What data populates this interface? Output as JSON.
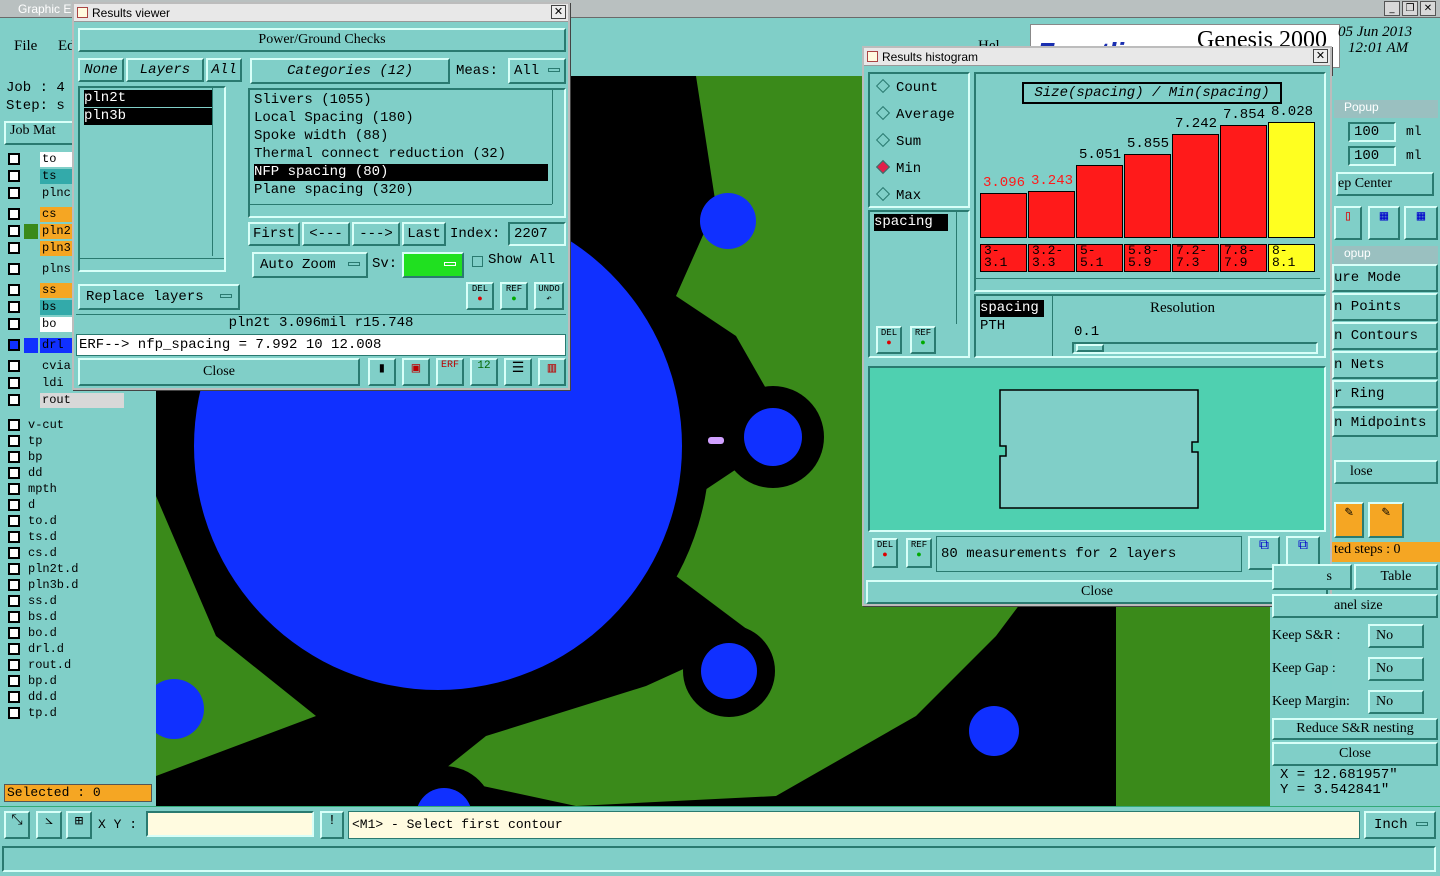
{
  "app": {
    "title": "Graphic E",
    "menu": [
      "File",
      "Ed"
    ],
    "brand": "Genesis 2000",
    "brand_logo": "Frontline",
    "date": "05 Jun 2013",
    "time": "12:01 AM",
    "help": "Hel"
  },
  "left": {
    "job_label": "Job  :  4",
    "step_label": "Step:  s",
    "job_matrix": "Job Mat",
    "layers": [
      {
        "name": "to",
        "color": "#ffffff",
        "style": "w"
      },
      {
        "name": "ts",
        "color": "#3aa",
        "style": "g"
      },
      {
        "name": "plnc",
        "color": "#80cfc8",
        "style": "n"
      },
      {
        "name": "cs",
        "color": "#f5a623",
        "style": "o"
      },
      {
        "name": "pln2",
        "color": "#e0a020",
        "style": "o2"
      },
      {
        "name": "pln3",
        "color": "#e0a020",
        "style": "o"
      },
      {
        "name": "plns",
        "color": "#80cfc8",
        "style": "n"
      },
      {
        "name": "ss",
        "color": "#f5a623",
        "style": "o"
      },
      {
        "name": "bs",
        "color": "#3aa",
        "style": "g"
      },
      {
        "name": "bo",
        "color": "#ffffff",
        "style": "w"
      },
      {
        "name": "drl",
        "color": "#1030ff",
        "style": "b"
      },
      {
        "name": "cvia",
        "color": "#80cfc8",
        "style": "n"
      },
      {
        "name": "ldi",
        "color": "#80cfc8",
        "style": "n"
      },
      {
        "name": "rout",
        "color": "#d8d8d8",
        "style": "gr"
      }
    ],
    "layers2": [
      "v-cut",
      "tp",
      "bp",
      "dd",
      "mpth",
      "d",
      "to.d",
      "ts.d",
      "cs.d",
      "pln2t.d",
      "pln3b.d",
      "ss.d",
      "bs.d",
      "bo.d",
      "drl.d",
      "rout.d",
      "bp.d",
      "dd.d",
      "tp.d"
    ],
    "selected": "Selected : 0"
  },
  "results_viewer": {
    "title": "Results viewer",
    "header": "Power/Ground Checks",
    "none_btn": "None",
    "layers_btn": "Layers",
    "all_btn": "All",
    "layers": [
      "pln2t",
      "pln3b"
    ],
    "categories_btn": "Categories (12)",
    "meas_label": "Meas:",
    "meas_value": "All",
    "categories": [
      "Slivers (1055)",
      "Local Spacing (180)",
      "Spoke width (88)",
      "Thermal connect reduction (32)",
      "NFP spacing (80)",
      "Plane spacing (320)"
    ],
    "selected_category": 4,
    "first": "First",
    "prev": "<---",
    "next": "--->",
    "last": "Last",
    "index_label": "Index:",
    "index_value": "2207",
    "auto_zoom": "Auto Zoom",
    "sv_label": "Sv:",
    "show_all": "Show All",
    "replace_layers": "Replace layers",
    "del": "DEL",
    "ref": "REF",
    "undo": "UNDO",
    "status": "pln2t 3.096mil  r15.748",
    "erf": "ERF--> nfp_spacing = 7.992 10 12.008",
    "close": "Close"
  },
  "histogram": {
    "title": "Results histogram",
    "modes": [
      "Count",
      "Average",
      "Sum",
      "Min",
      "Max"
    ],
    "selected_mode": "Min",
    "chart_title": "Size(spacing) / Min(spacing)",
    "bars": [
      {
        "value": "3.096",
        "v": 3.096,
        "range": "3-\n3.1",
        "color": "#ff1a1a"
      },
      {
        "value": "3.243",
        "v": 3.243,
        "range": "3.2-\n3.3",
        "color": "#ff1a1a"
      },
      {
        "value": "5.051",
        "v": 5.051,
        "range": "5-\n5.1",
        "color": "#ff1a1a"
      },
      {
        "value": "5.855",
        "v": 5.855,
        "range": "5.8-\n5.9",
        "color": "#ff1a1a"
      },
      {
        "value": "7.242",
        "v": 7.242,
        "range": "7.2-\n7.3",
        "color": "#ff1a1a"
      },
      {
        "value": "7.854",
        "v": 7.854,
        "range": "7.8-\n7.9",
        "color": "#ff1a1a"
      },
      {
        "value": "8.028",
        "v": 8.028,
        "range": "8-\n8.1",
        "color": "#ffff20"
      }
    ],
    "list1": [
      "spacing"
    ],
    "list2": [
      "spacing",
      "PTH"
    ],
    "resolution_label": "Resolution",
    "resolution_value": "0.1",
    "measurements": "80 measurements for 2 layers",
    "close": "Close"
  },
  "right_panel": {
    "popup1": "Popup",
    "ml1": "100",
    "ml2": "100",
    "ml_unit": "ml",
    "keep_center": "ep Center",
    "popup2": "opup",
    "modes": [
      "ure Mode",
      "n Points",
      "n Contours",
      "n Nets",
      "r Ring",
      "n Midpoints"
    ],
    "close1": "lose",
    "ted_steps": "ted steps : 0",
    "s_btn": "s",
    "table_btn": "Table",
    "panel_size": "anel size",
    "keep_sr": "Keep S&R  :",
    "keep_gap": "Keep Gap   :",
    "keep_margin": "Keep Margin:",
    "no": "No",
    "reduce": "Reduce S&R nesting",
    "close2": "Close",
    "x": "X = 12.681957\"",
    "y": "Y = 3.542841\""
  },
  "bottom": {
    "xy_label": "X Y :",
    "prompt": "<M1> - Select first contour",
    "units": "Inch"
  }
}
